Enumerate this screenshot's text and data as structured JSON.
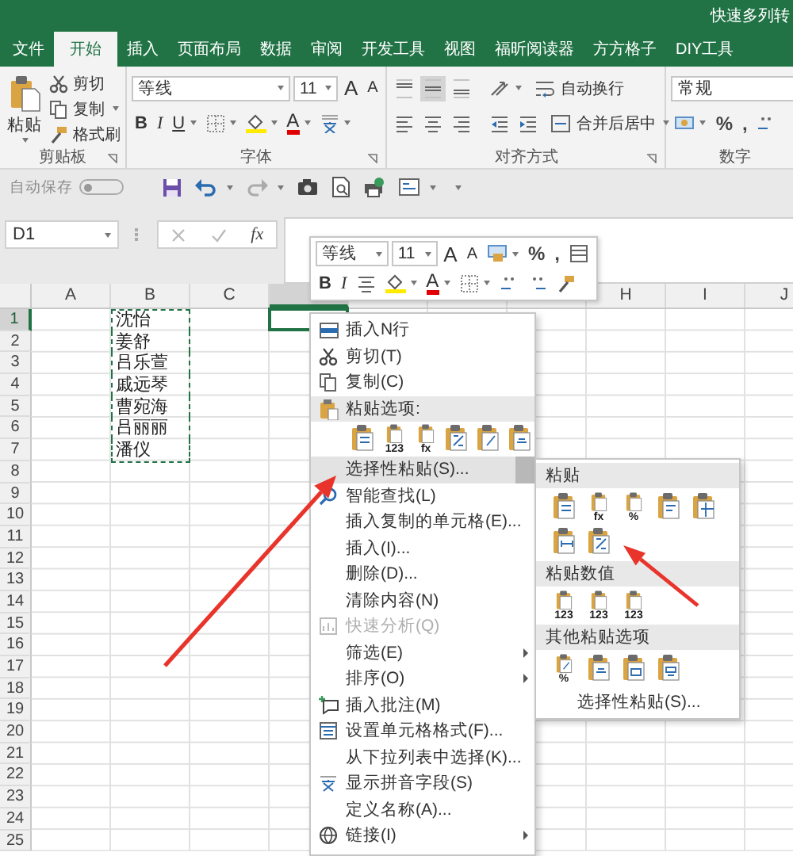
{
  "title_bar": {
    "title": "快速多列转"
  },
  "tabs": [
    {
      "label": "文件",
      "selected": false
    },
    {
      "label": "开始",
      "selected": true
    },
    {
      "label": "插入",
      "selected": false
    },
    {
      "label": "页面布局",
      "selected": false
    },
    {
      "label": "数据",
      "selected": false
    },
    {
      "label": "审阅",
      "selected": false
    },
    {
      "label": "开发工具",
      "selected": false
    },
    {
      "label": "视图",
      "selected": false
    },
    {
      "label": "福昕阅读器",
      "selected": false
    },
    {
      "label": "方方格子",
      "selected": false
    },
    {
      "label": "DIY工具",
      "selected": false
    }
  ],
  "ribbon": {
    "clipboard": {
      "paste": "粘贴",
      "cut": "剪切",
      "copy": "复制",
      "format_painter": "格式刷",
      "label": "剪贴板"
    },
    "font": {
      "font_name": "等线",
      "font_size": "11",
      "grow": "A",
      "shrink": "A",
      "bold": "B",
      "italic": "I",
      "underline": "U",
      "font_color": "A",
      "label": "字体"
    },
    "alignment": {
      "vertical": [
        {
          "selected": false
        },
        {
          "selected": true
        },
        {
          "selected": false
        }
      ],
      "wrap_text": "自动换行",
      "merge_center": "合并后居中",
      "label": "对齐方式"
    },
    "number": {
      "format": "常规",
      "percent": "%",
      "comma": ",",
      "label": "数字"
    }
  },
  "quick_access": {
    "autosave": "自动保存",
    "disabled": true,
    "toggle_on": false
  },
  "formula_bar": {
    "name_box": "D1",
    "function_label": "fx"
  },
  "mini_toolbar": {
    "font_name": "等线",
    "font_size": "11",
    "grow": "A",
    "shrink": "A",
    "percent": "%",
    "comma": ",",
    "bold": "B",
    "italic": "I",
    "font_color": "A"
  },
  "sheet": {
    "columns": [
      {
        "label": "A",
        "selected": false
      },
      {
        "label": "B",
        "selected": false
      },
      {
        "label": "C",
        "selected": false
      },
      {
        "selected": true
      },
      {
        "selected": false
      },
      {
        "selected": false
      },
      {
        "selected": false
      },
      {
        "label": "H",
        "selected": false
      },
      {
        "label": "I",
        "selected": false
      },
      {
        "label": "J",
        "selected": false
      }
    ],
    "rows": [
      {
        "number": "1",
        "selected": true,
        "b": "沈怡",
        "copied": true
      },
      {
        "number": "2",
        "selected": false,
        "b": "姜舒",
        "copied": true
      },
      {
        "number": "3",
        "selected": false,
        "b": "吕乐萱",
        "copied": true
      },
      {
        "number": "4",
        "selected": false,
        "b": "戚远琴",
        "copied": true
      },
      {
        "number": "5",
        "selected": false,
        "b": "曹宛海",
        "copied": true
      },
      {
        "number": "6",
        "selected": false,
        "b": "吕丽丽",
        "copied": true
      },
      {
        "number": "7",
        "selected": false,
        "b": "潘仪",
        "copied": true
      },
      {
        "number": "8",
        "selected": false,
        "copied": false
      },
      {
        "number": "9",
        "selected": false,
        "copied": false
      },
      {
        "number": "10",
        "selected": false,
        "copied": false
      },
      {
        "number": "11",
        "selected": false,
        "copied": false
      },
      {
        "number": "12",
        "selected": false,
        "copied": false
      },
      {
        "number": "13",
        "selected": false,
        "copied": false
      },
      {
        "number": "14",
        "selected": false,
        "copied": false
      },
      {
        "number": "15",
        "selected": false,
        "copied": false
      },
      {
        "number": "16",
        "selected": false,
        "copied": false
      },
      {
        "number": "17",
        "selected": false,
        "copied": false
      },
      {
        "number": "18",
        "selected": false,
        "copied": false
      },
      {
        "number": "19",
        "selected": false,
        "copied": false
      },
      {
        "number": "20",
        "selected": false,
        "copied": false
      },
      {
        "number": "21",
        "selected": false,
        "copied": false
      },
      {
        "number": "22",
        "selected": false,
        "copied": false
      },
      {
        "number": "23",
        "selected": false,
        "copied": false
      },
      {
        "number": "24",
        "selected": false,
        "copied": false
      },
      {
        "number": "25",
        "selected": false,
        "copied": false
      }
    ]
  },
  "context_menu": {
    "items": [
      {
        "kind": "item",
        "label": "插入N行",
        "selected": false,
        "disabled": false,
        "submenu": false
      },
      {
        "kind": "item",
        "label": "剪切(T)",
        "selected": false,
        "disabled": false,
        "submenu": false
      },
      {
        "kind": "item",
        "label": "复制(C)",
        "selected": false,
        "disabled": false,
        "submenu": false
      },
      {
        "kind": "header",
        "label": "粘贴选项:"
      },
      {
        "kind": "icons",
        "icons": [
          {
            "kind": "plain"
          },
          {
            "kind": "values",
            "badge": "123"
          },
          {
            "kind": "formulas",
            "badge": "fx"
          },
          {
            "kind": "transpose"
          },
          {
            "kind": "formatting"
          },
          {
            "kind": "link"
          }
        ]
      },
      {
        "kind": "item",
        "label": "选择性粘贴(S)...",
        "selected": true,
        "disabled": false,
        "submenu": true
      },
      {
        "kind": "item",
        "label": "智能查找(L)",
        "selected": false,
        "disabled": false,
        "submenu": false
      },
      {
        "kind": "item",
        "label": "插入复制的单元格(E)...",
        "selected": false,
        "disabled": false,
        "submenu": false
      },
      {
        "kind": "item",
        "label": "插入(I)...",
        "selected": false,
        "disabled": false,
        "submenu": false
      },
      {
        "kind": "item",
        "label": "删除(D)...",
        "selected": false,
        "disabled": false,
        "submenu": false
      },
      {
        "kind": "item",
        "label": "清除内容(N)",
        "selected": false,
        "disabled": false,
        "submenu": false
      },
      {
        "kind": "item",
        "label": "快速分析(Q)",
        "selected": false,
        "disabled": true,
        "submenu": false
      },
      {
        "kind": "item",
        "label": "筛选(E)",
        "selected": false,
        "disabled": false,
        "submenu": true
      },
      {
        "kind": "item",
        "label": "排序(O)",
        "selected": false,
        "disabled": false,
        "submenu": true
      },
      {
        "kind": "item",
        "label": "插入批注(M)",
        "selected": false,
        "disabled": false,
        "submenu": false
      },
      {
        "kind": "item",
        "label": "设置单元格格式(F)...",
        "selected": false,
        "disabled": false,
        "submenu": false
      },
      {
        "kind": "item",
        "label": "从下拉列表中选择(K)...",
        "selected": false,
        "disabled": false,
        "submenu": false
      },
      {
        "kind": "item",
        "label": "显示拼音字段(S)",
        "selected": false,
        "disabled": false,
        "submenu": false
      },
      {
        "kind": "item",
        "label": "定义名称(A)...",
        "selected": false,
        "disabled": false,
        "submenu": false
      },
      {
        "kind": "item",
        "label": "链接(I)",
        "selected": false,
        "disabled": false,
        "submenu": true
      }
    ]
  },
  "paste_submenu": {
    "sections": [
      {
        "title": "粘贴",
        "icons": [
          {
            "kind": "plain"
          },
          {
            "kind": "formulas",
            "badge": "fx"
          },
          {
            "kind": "formulas",
            "badge": "%"
          },
          {
            "kind": "keep_source"
          },
          {
            "kind": "no_borders"
          },
          {
            "kind": "column_widths"
          },
          {
            "kind": "transpose"
          }
        ]
      },
      {
        "title": "粘贴数值",
        "icons": [
          {
            "kind": "values",
            "badge": "123"
          },
          {
            "kind": "values",
            "badge": "123"
          },
          {
            "kind": "values",
            "badge": "123"
          }
        ]
      },
      {
        "title": "其他粘贴选项",
        "icons": [
          {
            "kind": "formatting",
            "badge": "%"
          },
          {
            "kind": "link"
          },
          {
            "kind": "picture"
          },
          {
            "kind": "linked_picture"
          }
        ]
      }
    ],
    "footer": "选择性粘贴(S)..."
  }
}
